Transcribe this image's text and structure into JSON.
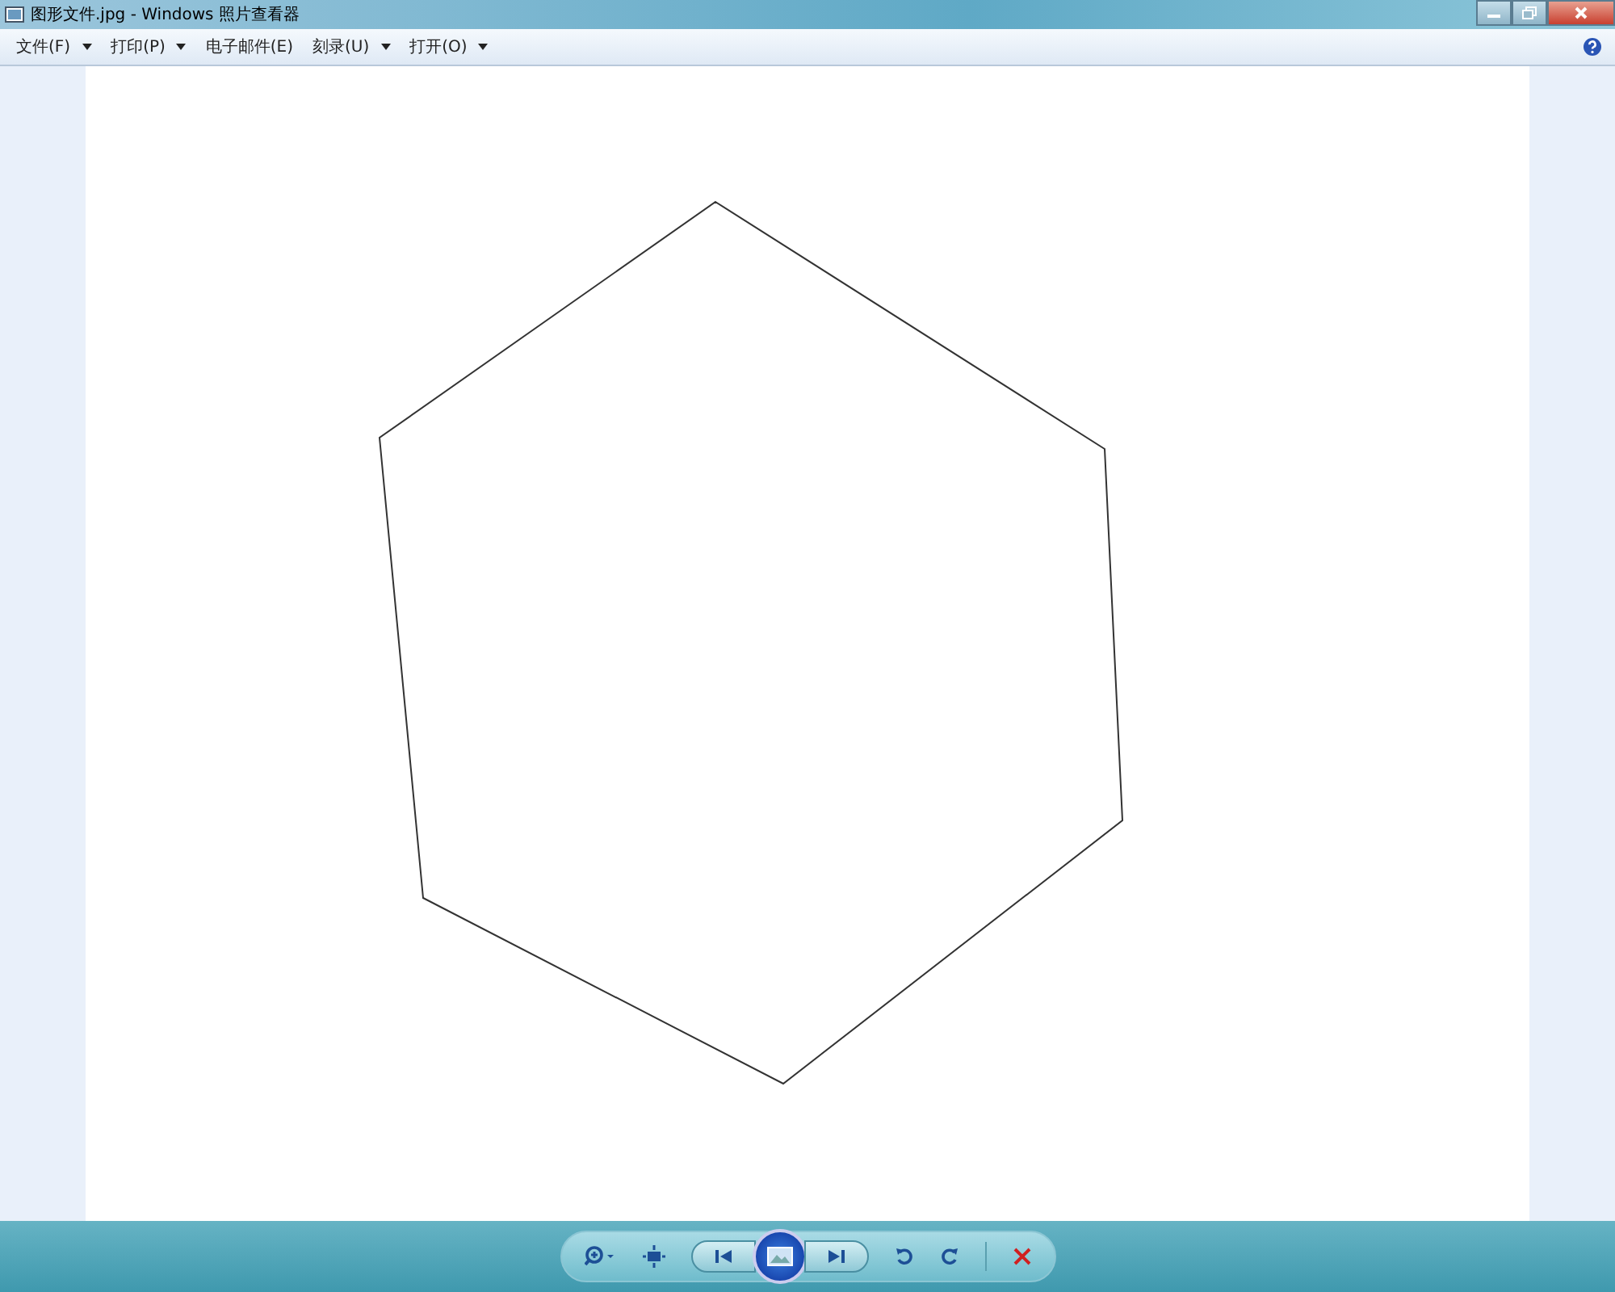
{
  "window": {
    "title": "图形文件.jpg - Windows 照片查看器"
  },
  "menu": [
    {
      "label": "文件(F)",
      "dropdown": true
    },
    {
      "label": "打印(P)",
      "dropdown": true
    },
    {
      "label": "电子邮件(E)",
      "dropdown": false
    },
    {
      "label": "刻录(U)",
      "dropdown": true
    },
    {
      "label": "打开(O)",
      "dropdown": true
    }
  ]
}
